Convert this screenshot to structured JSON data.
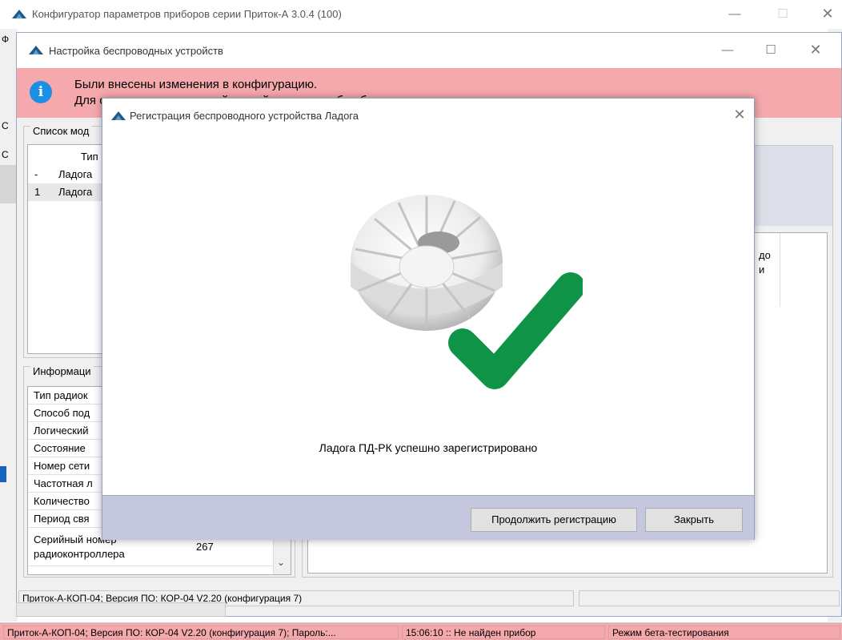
{
  "main_window": {
    "title": "Конфигуратор параметров приборов серии Приток-А  3.0.4 (100)"
  },
  "wireless_window": {
    "title": "Настройка беспроводных устройств",
    "info_line1": "Были внесены изменения в конфигурацию.",
    "info_line2": "Для сохранения изменений закройте окно, прибор будет перезагружен.",
    "modules_group_title": "Список мод",
    "list_header": "Тип",
    "list_rows": [
      {
        "num": "-",
        "type": "Ладога"
      },
      {
        "num": "1",
        "type": "Ладога"
      }
    ],
    "info_group_title": "Информаци",
    "props": [
      {
        "label": "Тип радиок"
      },
      {
        "label": "Способ под"
      },
      {
        "label": "Логический"
      },
      {
        "label": "Состояние"
      },
      {
        "label": "Номер сети"
      },
      {
        "label": "Частотная л"
      },
      {
        "label": "Количество"
      },
      {
        "label": "Период свя"
      }
    ],
    "serial_label_line1": "Серийный номер",
    "serial_label_line2": "радиоконтроллера",
    "serial_value": "267",
    "right_fragment_line1": "до",
    "right_fragment_line2": "и",
    "inner_status": "Приток-А-КОП-04; Версия ПО: КОР-04 V2.20 (конфигурация 7)"
  },
  "modal": {
    "title": "Регистрация беспроводного устройства Ладога",
    "message": "Ладога ПД-РК успешно зарегистрировано",
    "continue_button": "Продолжить регистрацию",
    "close_button": "Закрыть",
    "check_color": "#0f9447"
  },
  "status_bar": {
    "device": "Приток-А-КОП-04; Версия ПО: КОР-04 V2.20 (конфигурация 7); Пароль:...",
    "time_status": "15:06:10 :: Не найден прибор",
    "mode": "Режим бета-тестирования"
  },
  "accent_colors": {
    "info_bar": "#f6a9ad",
    "footer": "#c4c7dd"
  }
}
